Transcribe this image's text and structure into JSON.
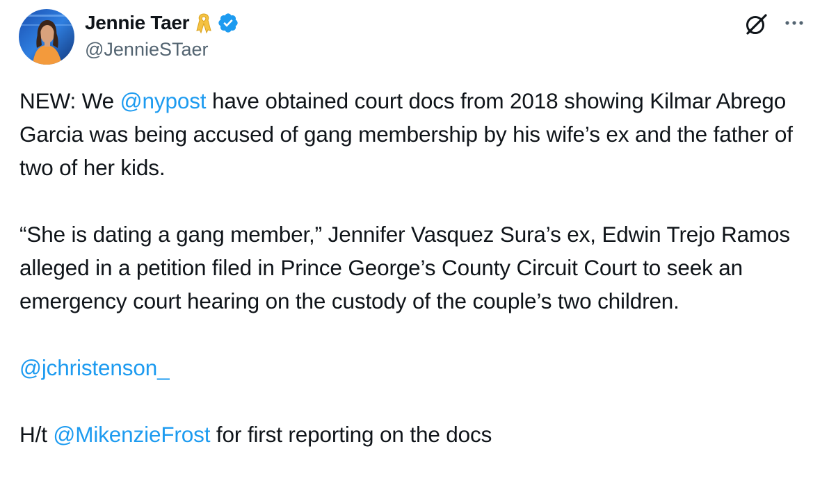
{
  "author": {
    "display_name": "Jennie Taer",
    "handle": "@JennieSTaer",
    "badges": [
      "yellow-ribbon-icon",
      "verified-badge-icon"
    ],
    "verified_color": "#1d9bf0",
    "ribbon_color": "#f5c242"
  },
  "actions": {
    "grok_icon": "grok-icon",
    "more_icon": "more-options-icon"
  },
  "tweet": {
    "p1": {
      "t1": "NEW: We ",
      "mention": "@nypost",
      "t2": " have obtained court docs from 2018 showing Kilmar Abrego Garcia was being accused of gang membership by his wife’s ex and the father of two of her kids."
    },
    "p2": {
      "text": "“She is dating a gang member,” Jennifer Vasquez Sura’s ex, Edwin Trejo Ramos alleged in a petition filed in Prince George’s County Circuit Court to seek an emergency court hearing on the custody of the couple’s two children."
    },
    "p3": {
      "mention": "@jchristenson_"
    },
    "p4": {
      "t1": "H/t ",
      "mention": "@MikenzieFrost",
      "t2": " for first reporting on the docs"
    }
  },
  "colors": {
    "text": "#0f1419",
    "secondary": "#536471",
    "link": "#1d9bf0"
  }
}
